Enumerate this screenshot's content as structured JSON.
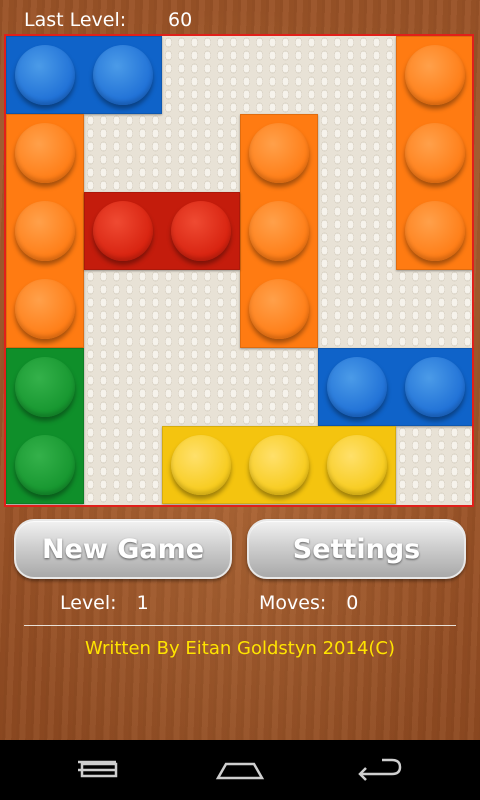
{
  "header": {
    "last_level_label": "Last Level:",
    "last_level_value": "60"
  },
  "board": {
    "pieces": [
      {
        "name": "blue-block-top",
        "color": "blue"
      },
      {
        "name": "orange-block-right-top",
        "color": "orange"
      },
      {
        "name": "orange-block-left",
        "color": "orange"
      },
      {
        "name": "orange-block-center",
        "color": "orange"
      },
      {
        "name": "red-target-block",
        "color": "red"
      },
      {
        "name": "green-block",
        "color": "green"
      },
      {
        "name": "blue-block-right",
        "color": "blue"
      },
      {
        "name": "yellow-block",
        "color": "yellow"
      }
    ]
  },
  "buttons": {
    "new_game": "New Game",
    "settings": "Settings"
  },
  "stats": {
    "level_label": "Level:",
    "level_value": "1",
    "moves_label": "Moves:",
    "moves_value": "0"
  },
  "footer": {
    "credit": "Written By Eitan Goldstyn 2014(C)"
  },
  "nav": {
    "back_icon": "back-icon",
    "home_icon": "home-icon",
    "recent_icon": "recent-apps-icon"
  }
}
